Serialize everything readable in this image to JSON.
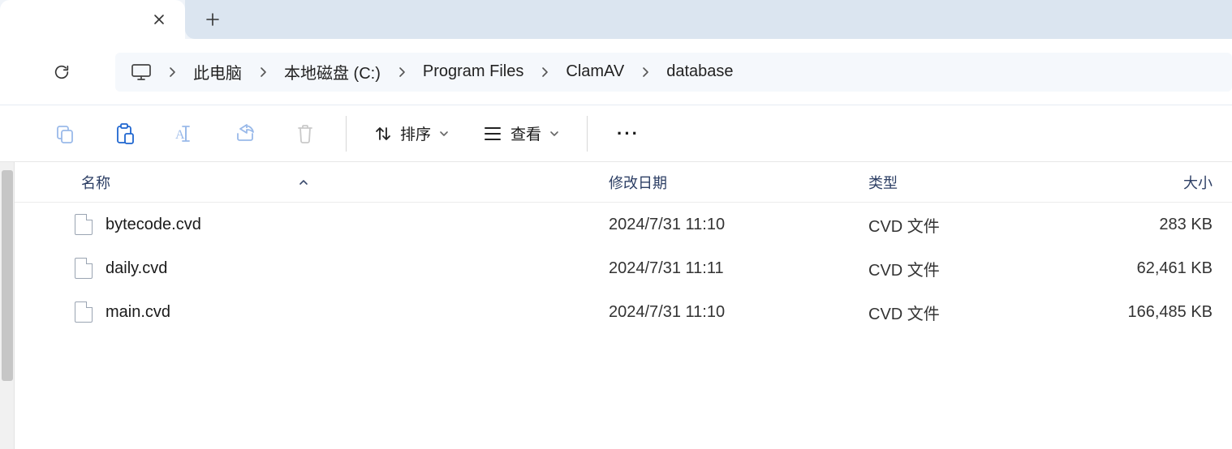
{
  "breadcrumb": {
    "this_pc": "此电脑",
    "drive": "本地磁盘 (C:)",
    "segments": [
      "Program Files",
      "ClamAV",
      "database"
    ]
  },
  "toolbar": {
    "sort_label": "排序",
    "view_label": "查看"
  },
  "columns": {
    "name": "名称",
    "modified": "修改日期",
    "type": "类型",
    "size": "大小"
  },
  "files": [
    {
      "name": "bytecode.cvd",
      "modified": "2024/7/31 11:10",
      "type": "CVD 文件",
      "size": "283 KB"
    },
    {
      "name": "daily.cvd",
      "modified": "2024/7/31 11:11",
      "type": "CVD 文件",
      "size": "62,461 KB"
    },
    {
      "name": "main.cvd",
      "modified": "2024/7/31 11:10",
      "type": "CVD 文件",
      "size": "166,485 KB"
    }
  ]
}
